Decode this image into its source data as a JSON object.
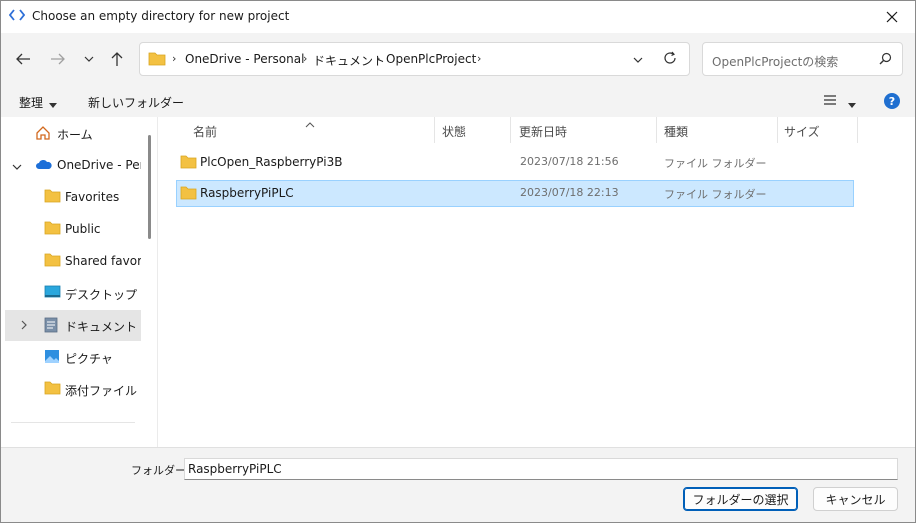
{
  "window": {
    "title": "Choose an empty directory for new project"
  },
  "address": {
    "crumbs": [
      "OneDrive - Personal",
      "ドキュメント",
      "OpenPlcProject"
    ]
  },
  "search": {
    "placeholder": "OpenPlcProjectの検索"
  },
  "toolbar": {
    "organize_label": "整理",
    "new_folder_label": "新しいフォルダー"
  },
  "sidebar": {
    "items": [
      {
        "label": "ホーム",
        "icon": "home-icon"
      },
      {
        "label": "OneDrive - Perso",
        "icon": "cloud-icon"
      },
      {
        "label": "Favorites",
        "icon": "folder-icon"
      },
      {
        "label": "Public",
        "icon": "folder-icon"
      },
      {
        "label": "Shared favorite",
        "icon": "folder-icon"
      },
      {
        "label": "デスクトップ",
        "icon": "desktop-icon"
      },
      {
        "label": "ドキュメント",
        "icon": "document-icon"
      },
      {
        "label": "ピクチャ",
        "icon": "picture-icon"
      },
      {
        "label": "添付ファイル",
        "icon": "folder-icon"
      }
    ]
  },
  "filelist": {
    "columns": {
      "name": "名前",
      "status": "状態",
      "modified": "更新日時",
      "type": "種類",
      "size": "サイズ"
    },
    "rows": [
      {
        "name": "PlcOpen_RaspberryPi3B",
        "modified": "2023/07/18 21:56",
        "type": "ファイル フォルダー"
      },
      {
        "name": "RaspberryPiPLC",
        "modified": "2023/07/18 22:13",
        "type": "ファイル フォルダー"
      }
    ]
  },
  "footer": {
    "folder_label": "フォルダー:",
    "folder_value": "RaspberryPiPLC",
    "select_button": "フォルダーの選択",
    "cancel_button": "キャンセル"
  },
  "colors": {
    "accent": "#005fb8",
    "selection_bg": "#cce8ff",
    "folder_yellow": "#f3c142"
  }
}
